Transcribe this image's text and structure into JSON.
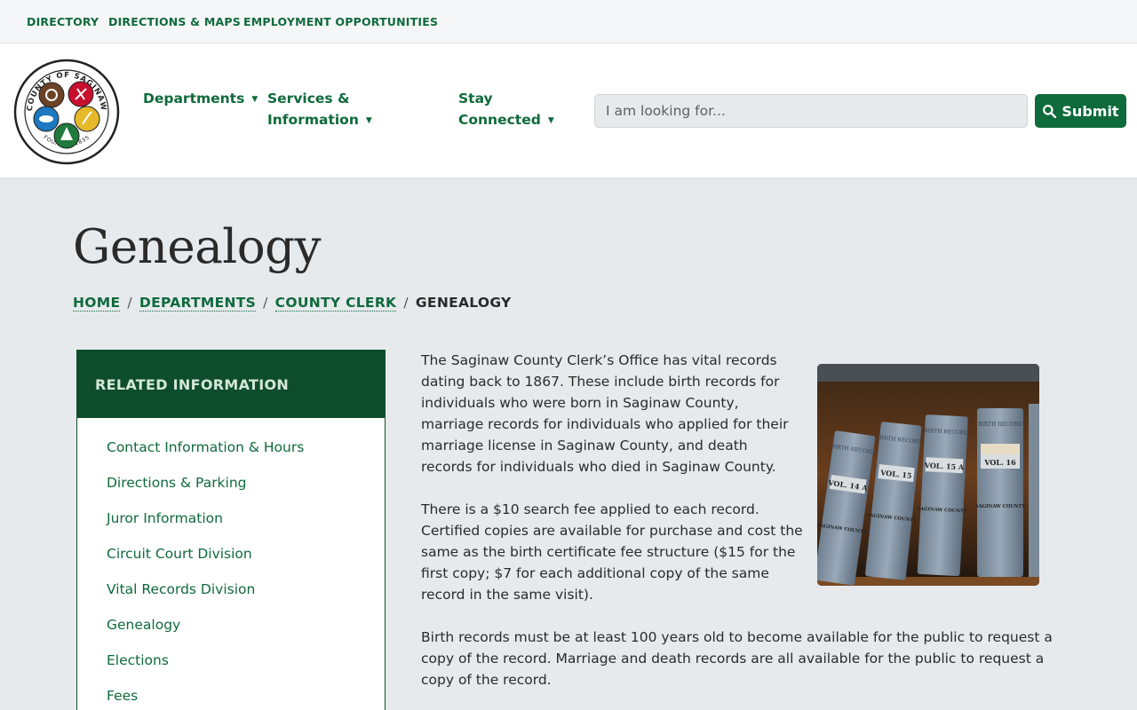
{
  "utility_nav": [
    "DIRECTORY",
    "DIRECTIONS & MAPS",
    "EMPLOYMENT OPPORTUNITIES"
  ],
  "logo": {
    "top_text": "COUNTY OF SAGINAW",
    "bottom_text": "FOUNDED 1835"
  },
  "main_nav": [
    {
      "line1": "Departments",
      "line2": ""
    },
    {
      "line1": "Services &",
      "line2": "Information"
    },
    {
      "line1": "Stay",
      "line2": "Connected"
    }
  ],
  "search": {
    "placeholder": "I am looking for...",
    "submit_label": "Submit"
  },
  "page": {
    "title": "Genealogy"
  },
  "breadcrumb": {
    "items": [
      "HOME",
      "DEPARTMENTS",
      "COUNTY CLERK"
    ],
    "current": "GENEALOGY"
  },
  "sidebar": {
    "heading": "RELATED INFORMATION",
    "items": [
      "Contact Information & Hours",
      "Directions & Parking",
      "Juror Information",
      "Circuit Court Division",
      "Vital Records Division",
      "Genealogy",
      "Elections",
      "Fees"
    ]
  },
  "content": {
    "paragraphs": [
      "The Saginaw County Clerk’s Office has vital records dating back to 1867.  These include birth records for individuals who were born in Saginaw County, marriage records for individuals who applied for their marriage license in Saginaw County, and death records for individuals who died in Saginaw County.",
      "There is a $10 search fee applied to each record. Certified copies are available for purchase and cost the same as the birth certificate fee structure ($15 for the first copy; $7 for each additional copy of the same record in the same visit).",
      "Birth records must be at least 100 years old to become available for the public to request a copy of the record. Marriage and death records are all available for the public to request a copy of the record."
    ],
    "photo_books": [
      {
        "spine_top": "BIRTH RECORD",
        "volume": "VOL. 14 A",
        "county": "SAGINAW COUNTY"
      },
      {
        "spine_top": "BIRTH RECORD",
        "volume": "VOL. 15",
        "county": "SAGINAW COUNTY"
      },
      {
        "spine_top": "BIRTH RECORD",
        "volume": "VOL. 15 A",
        "county": "SAGINAW COUNTY"
      },
      {
        "spine_top": "BIRTH RECORD",
        "volume": "VOL. 16",
        "county": "SAGINAW COUNTY"
      }
    ]
  },
  "colors": {
    "brand_green": "#0f6a3c",
    "sidebar_header": "#0e4d2c",
    "page_background": "#e7eaed"
  }
}
